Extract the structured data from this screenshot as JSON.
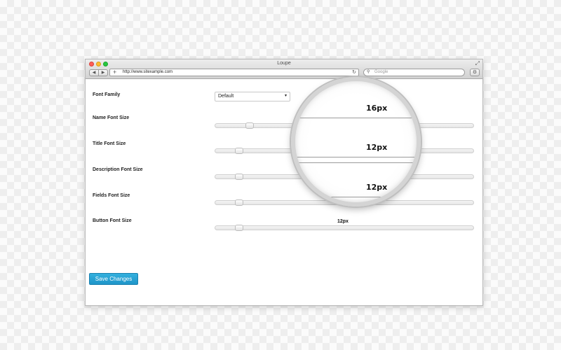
{
  "window": {
    "title": "Loupe",
    "nav": {
      "back": "◀",
      "forward": "▶"
    },
    "address": {
      "add": "+",
      "url": "http://www.sitexample.com",
      "reload": "↻"
    },
    "search": {
      "icon": "⚲",
      "placeholder": "Google"
    },
    "gear": "⚙",
    "resize": "⤢"
  },
  "form": {
    "font_family": {
      "label": "Font Family",
      "value": "Default",
      "arrow": "▾"
    },
    "sliders": [
      {
        "label": "Name Font Size",
        "value": "16px",
        "level": 0.12
      },
      {
        "label": "Title Font Size",
        "value": "12px",
        "level": 0.08
      },
      {
        "label": "Description Font Size",
        "value": "12px",
        "level": 0.08
      },
      {
        "label": "Fields Font Size",
        "value": "12px",
        "level": 0.08
      },
      {
        "label": "Button Font Size",
        "value": "12px",
        "level": 0.08
      }
    ],
    "save_label": "Save Changes"
  },
  "loupe": {
    "lines": [
      "16px",
      "12px",
      "12px"
    ]
  },
  "colors": {
    "accent": "#2aa6d6",
    "button_text": "#ffffff"
  }
}
